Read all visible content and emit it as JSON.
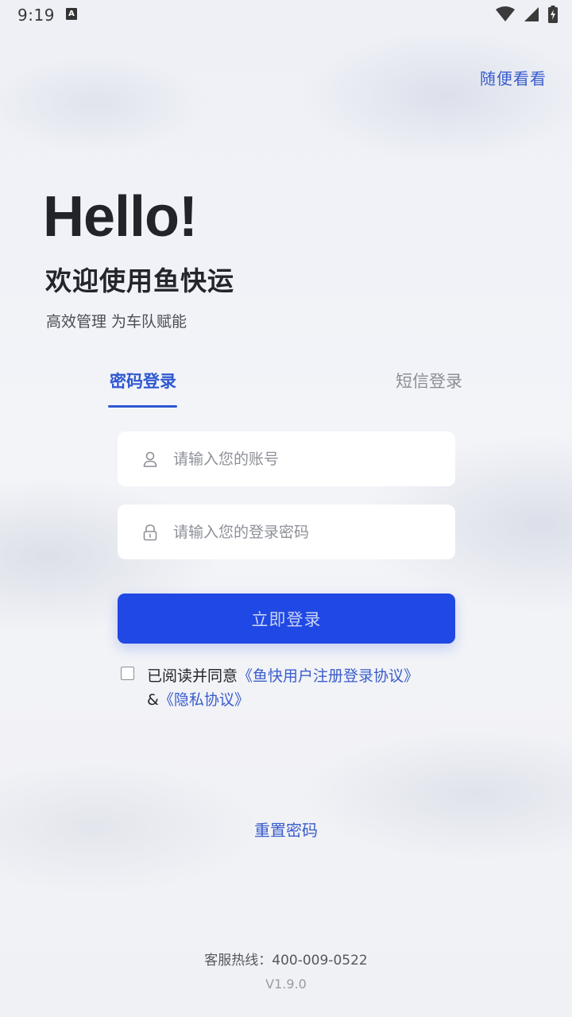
{
  "status_bar": {
    "time": "9:19",
    "notification_icon": "a-app-icon",
    "icons": [
      "wifi-icon",
      "signal-icon",
      "battery-charging-icon"
    ]
  },
  "header": {
    "skip_label": "随便看看"
  },
  "hero": {
    "greeting": "Hello!",
    "welcome": "欢迎使用鱼快运",
    "subtitle": "高效管理 为车队赋能"
  },
  "tabs": [
    {
      "label": "密码登录",
      "active": true
    },
    {
      "label": "短信登录",
      "active": false
    }
  ],
  "form": {
    "account": {
      "placeholder": "请输入您的账号",
      "value": "",
      "icon": "user-icon"
    },
    "password": {
      "placeholder": "请输入您的登录密码",
      "value": "",
      "icon": "lock-icon"
    },
    "submit_label": "立即登录"
  },
  "agreement": {
    "checked": false,
    "prefix": "已阅读并同意",
    "user_agreement": "《鱼快用户注册登录协议》",
    "joiner": "&",
    "privacy_policy": "《隐私协议》"
  },
  "reset_label": "重置密码",
  "footer": {
    "hotline": "客服热线：400-009-0522",
    "version": "V1.9.0"
  },
  "colors": {
    "accent": "#2E58D0",
    "button": "#2048E4",
    "link": "#3A5DCC",
    "background": "#F0F1F5"
  }
}
